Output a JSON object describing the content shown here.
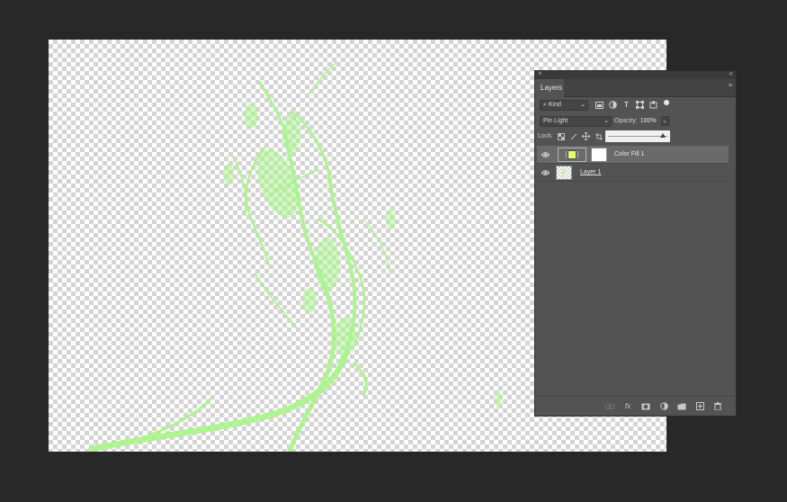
{
  "panel": {
    "close_glyph": "×",
    "collapse_glyph": "«",
    "tab_title": "Layers",
    "menu_glyph": "≡"
  },
  "filter": {
    "kind_label": "Kind",
    "chevron": "⌄",
    "icons": [
      "image-filter-icon",
      "adjustment-filter-icon",
      "type-filter-icon",
      "shape-filter-icon",
      "smart-object-filter-icon",
      "filter-toggle-icon"
    ]
  },
  "blend": {
    "mode": "Pin Light",
    "chevron": "⌄",
    "opacity_label": "Opacity:",
    "opacity_value": "100%",
    "opacity_btn": "⌄",
    "opacity_slider_fraction": 0.93
  },
  "lock": {
    "label": "Lock:"
  },
  "layers": [
    {
      "name": "Color Fill 1",
      "visible": true,
      "selected": true,
      "fill_color": "#e8ff6a"
    },
    {
      "name": "Layer 1",
      "visible": true,
      "selected": false
    }
  ],
  "colors": {
    "smoke": "#a9f58a",
    "fill_swatch": "#e8ff6a"
  }
}
